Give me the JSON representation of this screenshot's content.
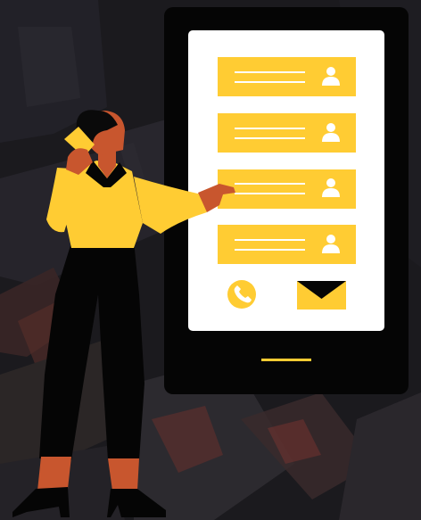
{
  "illustration": {
    "subject": "woman-on-phone-pointing-at-contact-list",
    "phone_screen": {
      "contact_cards": [
        {
          "icon": "user-icon"
        },
        {
          "icon": "user-icon"
        },
        {
          "icon": "user-icon"
        },
        {
          "icon": "user-icon"
        }
      ],
      "action_icons": [
        "phone-call-icon",
        "mail-envelope-icon"
      ]
    }
  },
  "colors": {
    "background": "#1c1a1f",
    "accent_yellow": "#ffcc33",
    "device_black": "#050505",
    "screen_white": "#ffffff",
    "skin": "#c8562e",
    "hair": "#0a0a0a",
    "pants": "#050505"
  }
}
